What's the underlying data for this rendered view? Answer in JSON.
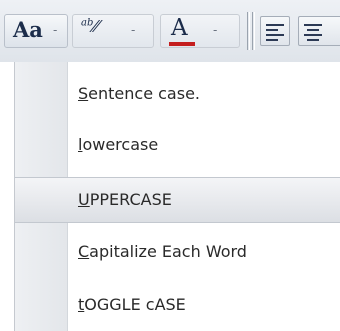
{
  "toolbar": {
    "change_case_label": "Aa",
    "highlight_label": "ab",
    "font_color_label": "A",
    "font_color_bar": "#c41e1e",
    "caret": "-"
  },
  "menu": {
    "items": [
      {
        "mnemonic": "S",
        "rest": "entence case.",
        "selected": false
      },
      {
        "mnemonic": "l",
        "rest": "owercase",
        "selected": false
      },
      {
        "mnemonic": "U",
        "rest": "PPERCASE",
        "selected": true
      },
      {
        "mnemonic": "C",
        "rest": "apitalize Each Word",
        "selected": false
      },
      {
        "mnemonic": "t",
        "rest": "OGGLE cASE",
        "selected": false
      }
    ]
  }
}
